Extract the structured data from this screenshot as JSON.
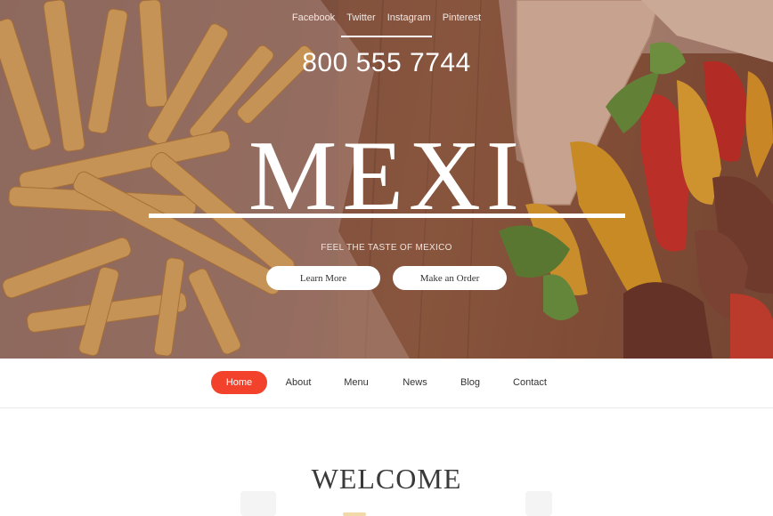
{
  "hero": {
    "social_links": [
      "Facebook",
      "Twitter",
      "Instagram",
      "Pinterest"
    ],
    "phone": "800 555 7744",
    "logo": "MEXI",
    "tagline": "FEEL THE TASTE OF MEXICO",
    "buttons": {
      "learn_more": "Learn More",
      "make_order": "Make an Order"
    },
    "background_image": "fries-and-burrito-photo"
  },
  "nav": {
    "items": [
      "Home",
      "About",
      "Menu",
      "News",
      "Blog",
      "Contact"
    ],
    "active_index": 0,
    "active_color": "#f2422b"
  },
  "welcome": {
    "title": "WELCOME"
  }
}
